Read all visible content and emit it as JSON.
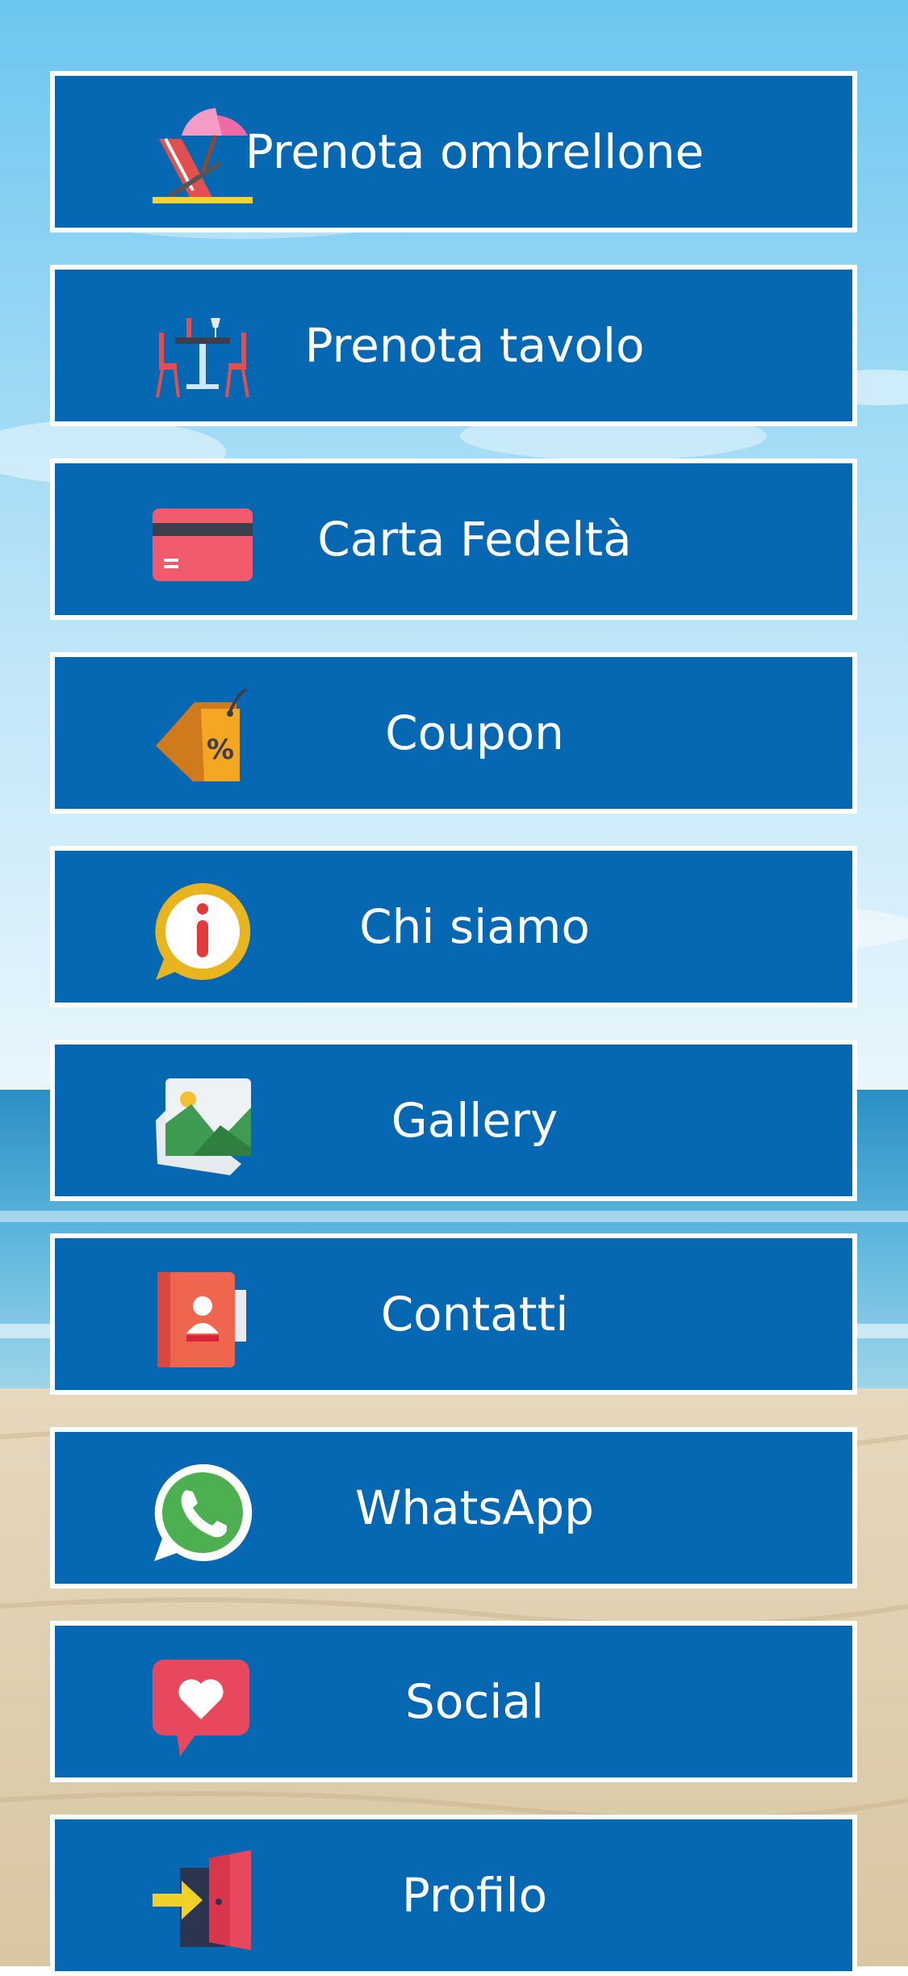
{
  "menu": {
    "items": [
      {
        "label": "Prenota ombrellone",
        "icon": "beach-umbrella-icon"
      },
      {
        "label": "Prenota tavolo",
        "icon": "restaurant-table-icon"
      },
      {
        "label": "Carta Fedeltà",
        "icon": "loyalty-card-icon"
      },
      {
        "label": "Coupon",
        "icon": "discount-tag-icon"
      },
      {
        "label": "Chi siamo",
        "icon": "info-icon"
      },
      {
        "label": "Gallery",
        "icon": "gallery-icon"
      },
      {
        "label": "Contatti",
        "icon": "contacts-book-icon"
      },
      {
        "label": "WhatsApp",
        "icon": "whatsapp-icon"
      },
      {
        "label": "Social",
        "icon": "heart-chat-icon"
      },
      {
        "label": "Profilo",
        "icon": "login-door-icon"
      }
    ]
  },
  "colors": {
    "button_background": "#0668b3",
    "button_border": "#ffffff",
    "button_text": "#ffffff"
  }
}
